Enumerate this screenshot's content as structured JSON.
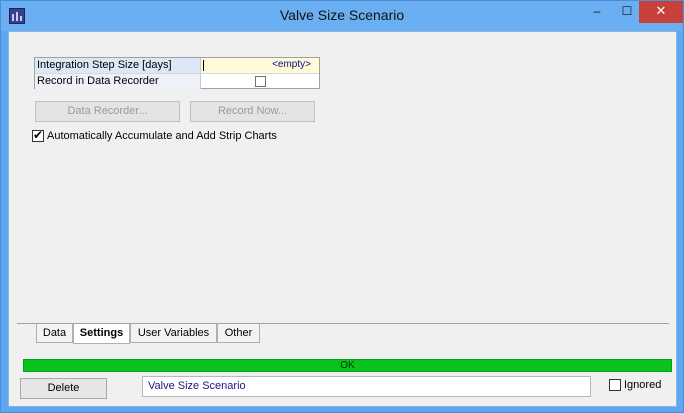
{
  "window": {
    "title": "Valve Size Scenario",
    "controls": {
      "minimize": "–",
      "maximize": "☐",
      "close": "✕"
    },
    "colors": {
      "titlebar": "#6aaff2",
      "close": "#c7403a"
    }
  },
  "properties": [
    {
      "name": "Integration Step Size [days]",
      "value": "<empty>"
    },
    {
      "name": "Record in Data Recorder",
      "checked": false
    }
  ],
  "buttons": {
    "data_recorder": "Data Recorder...",
    "record_now": "Record Now..."
  },
  "auto_accumulate": {
    "label": "Automatically Accumulate and Add Strip Charts",
    "checked": true
  },
  "tabs": [
    {
      "label": "Data",
      "active": false
    },
    {
      "label": "Settings",
      "active": true
    },
    {
      "label": "User Variables",
      "active": false
    },
    {
      "label": "Other",
      "active": false
    }
  ],
  "status": {
    "text": "OK",
    "color": "#0ac31f"
  },
  "footer": {
    "delete_label": "Delete",
    "name_value": "Valve Size Scenario",
    "ignored_label": "Ignored",
    "ignored_checked": false
  }
}
